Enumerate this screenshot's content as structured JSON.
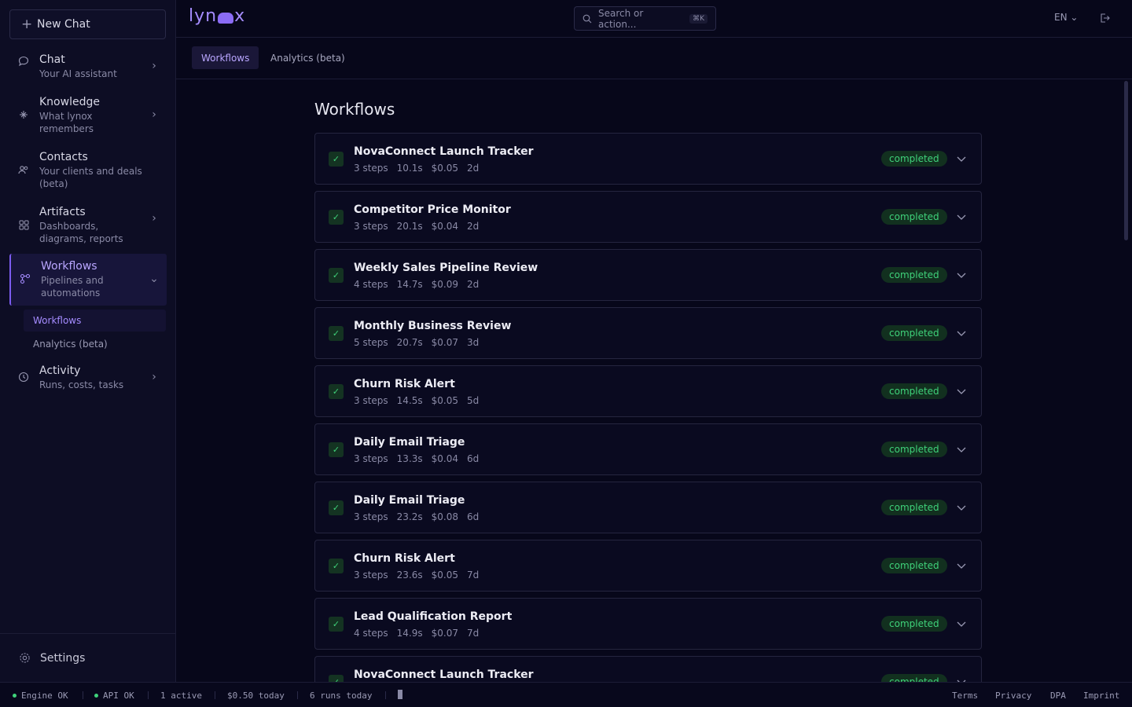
{
  "sidebar": {
    "new_chat_label": "New Chat",
    "items": [
      {
        "label": "Chat",
        "sub": "Your AI assistant"
      },
      {
        "label": "Knowledge",
        "sub1": "What lynox",
        "sub2": "remembers"
      },
      {
        "label": "Contacts",
        "sub1": "Your clients and deals",
        "sub2": "(beta)"
      },
      {
        "label": "Artifacts",
        "sub1": "Dashboards,",
        "sub2": "diagrams, reports"
      },
      {
        "label": "Workflows",
        "sub1": "Pipelines and",
        "sub2": "automations"
      },
      {
        "label": "Activity",
        "sub": "Runs, costs, tasks"
      }
    ],
    "subnav": [
      "Workflows",
      "Analytics (beta)"
    ],
    "settings_label": "Settings"
  },
  "header": {
    "logo_left": "lyn",
    "logo_right": "x",
    "search_placeholder": "Search or action...",
    "search_shortcut": "⌘K",
    "language": "EN ⌄"
  },
  "tabs": [
    "Workflows",
    "Analytics (beta)"
  ],
  "main": {
    "title": "Workflows",
    "workflows": [
      {
        "name": "NovaConnect Launch Tracker",
        "steps": "3 steps",
        "duration": "10.1s",
        "cost": "$0.05",
        "age": "2d",
        "status": "completed"
      },
      {
        "name": "Competitor Price Monitor",
        "steps": "3 steps",
        "duration": "20.1s",
        "cost": "$0.04",
        "age": "2d",
        "status": "completed"
      },
      {
        "name": "Weekly Sales Pipeline Review",
        "steps": "4 steps",
        "duration": "14.7s",
        "cost": "$0.09",
        "age": "2d",
        "status": "completed"
      },
      {
        "name": "Monthly Business Review",
        "steps": "5 steps",
        "duration": "20.7s",
        "cost": "$0.07",
        "age": "3d",
        "status": "completed"
      },
      {
        "name": "Churn Risk Alert",
        "steps": "3 steps",
        "duration": "14.5s",
        "cost": "$0.05",
        "age": "5d",
        "status": "completed"
      },
      {
        "name": "Daily Email Triage",
        "steps": "3 steps",
        "duration": "13.3s",
        "cost": "$0.04",
        "age": "6d",
        "status": "completed"
      },
      {
        "name": "Daily Email Triage",
        "steps": "3 steps",
        "duration": "23.2s",
        "cost": "$0.08",
        "age": "6d",
        "status": "completed"
      },
      {
        "name": "Churn Risk Alert",
        "steps": "3 steps",
        "duration": "23.6s",
        "cost": "$0.05",
        "age": "7d",
        "status": "completed"
      },
      {
        "name": "Lead Qualification Report",
        "steps": "4 steps",
        "duration": "14.9s",
        "cost": "$0.07",
        "age": "7d",
        "status": "completed"
      },
      {
        "name": "NovaConnect Launch Tracker",
        "steps": "",
        "duration": "",
        "cost": "",
        "age": "",
        "status": "completed"
      }
    ]
  },
  "statusbar": {
    "engine": "Engine OK",
    "api": "API OK",
    "active": "1 active",
    "cost_today": "$0.50 today",
    "runs_today": "6 runs today",
    "links": [
      "Terms",
      "Privacy",
      "DPA",
      "Imprint"
    ]
  },
  "colors": {
    "accent": "#7c5cf0",
    "success": "#3fd27a",
    "background": "#07071a"
  }
}
